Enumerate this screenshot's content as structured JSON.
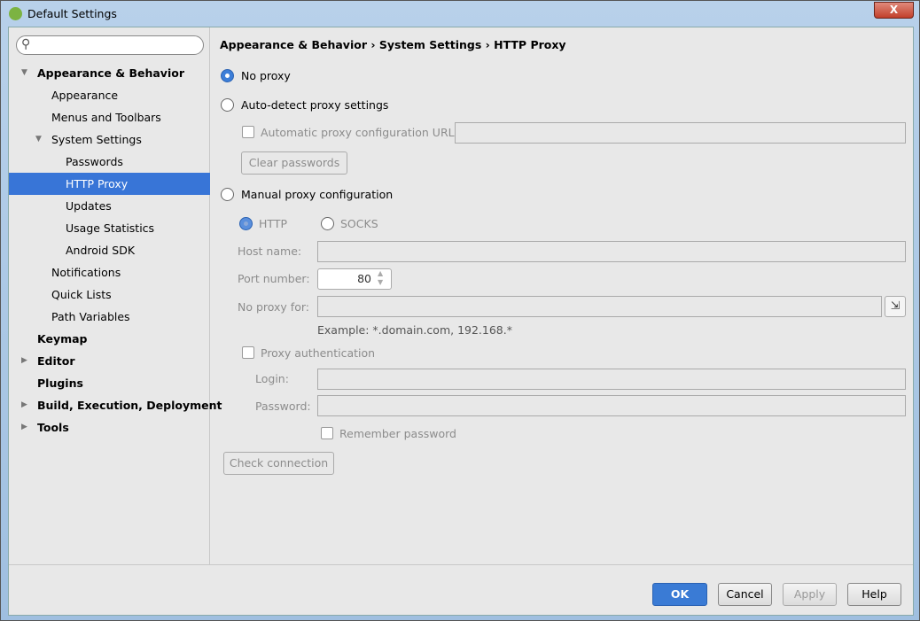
{
  "window": {
    "title": "Default Settings",
    "close_label": "X"
  },
  "search": {
    "placeholder": ""
  },
  "sidebar": {
    "items": [
      {
        "label": "Appearance & Behavior",
        "level": 0,
        "bold": true,
        "arrow": "▼"
      },
      {
        "label": "Appearance",
        "level": 1
      },
      {
        "label": "Menus and Toolbars",
        "level": 1
      },
      {
        "label": "System Settings",
        "level": 1,
        "arrow": "▼"
      },
      {
        "label": "Passwords",
        "level": 2
      },
      {
        "label": "HTTP Proxy",
        "level": 2,
        "selected": true
      },
      {
        "label": "Updates",
        "level": 2
      },
      {
        "label": "Usage Statistics",
        "level": 2
      },
      {
        "label": "Android SDK",
        "level": 2
      },
      {
        "label": "Notifications",
        "level": 1
      },
      {
        "label": "Quick Lists",
        "level": 1
      },
      {
        "label": "Path Variables",
        "level": 1
      },
      {
        "label": "Keymap",
        "level": 0,
        "bold": true
      },
      {
        "label": "Editor",
        "level": 0,
        "bold": true,
        "arrow": "▶"
      },
      {
        "label": "Plugins",
        "level": 0,
        "bold": true
      },
      {
        "label": "Build, Execution, Deployment",
        "level": 0,
        "bold": true,
        "arrow": "▶"
      },
      {
        "label": "Tools",
        "level": 0,
        "bold": true,
        "arrow": "▶"
      }
    ]
  },
  "breadcrumb": "Appearance & Behavior › System Settings › HTTP Proxy",
  "proxy": {
    "no_proxy": "No proxy",
    "auto_detect": "Auto-detect proxy settings",
    "auto_url_label": "Automatic proxy configuration URL:",
    "auto_url_value": "",
    "clear_passwords": "Clear passwords",
    "manual": "Manual proxy configuration",
    "http": "HTTP",
    "socks": "SOCKS",
    "host_label": "Host name:",
    "host_value": "",
    "port_label": "Port number:",
    "port_value": "80",
    "no_proxy_for_label": "No proxy for:",
    "no_proxy_for_value": "",
    "example": "Example: *.domain.com, 192.168.*",
    "proxy_auth": "Proxy authentication",
    "login_label": "Login:",
    "login_value": "",
    "password_label": "Password:",
    "password_value": "",
    "remember": "Remember password",
    "check_connection": "Check connection"
  },
  "footer": {
    "ok": "OK",
    "cancel": "Cancel",
    "apply": "Apply",
    "help": "Help"
  },
  "colors": {
    "accent": "#3875d7"
  }
}
